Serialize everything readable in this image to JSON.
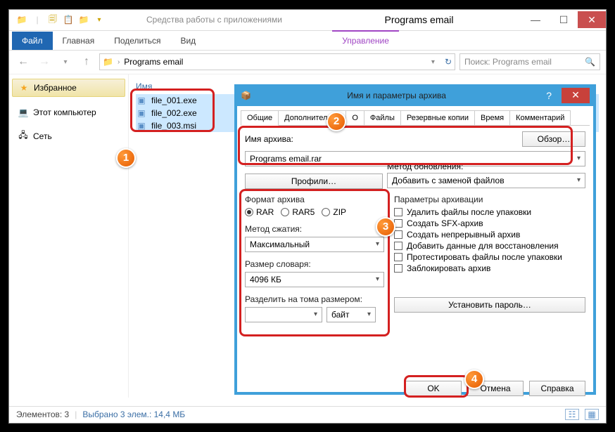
{
  "window": {
    "context_tab": "Средства работы с приложениями",
    "title": "Programs email"
  },
  "ribbon": {
    "file": "Файл",
    "home": "Главная",
    "share": "Поделиться",
    "view": "Вид",
    "ctx": "Управление"
  },
  "nav": {
    "folder": "Programs email",
    "search_placeholder": "Поиск: Programs email"
  },
  "sidebar": {
    "favorites": "Избранное",
    "pc": "Этот компьютер",
    "network": "Сеть"
  },
  "files": {
    "header": "Имя",
    "items": [
      "file_001.exe",
      "file_002.exe",
      "file_003.msi"
    ]
  },
  "status": {
    "elements": "Элементов: 3",
    "selected": "Выбрано 3 элем.: 14,4 МБ"
  },
  "dialog": {
    "title": "Имя и параметры архива",
    "tabs": [
      "Общие",
      "Дополнительно",
      "О",
      "Файлы",
      "Резервные копии",
      "Время",
      "Комментарий"
    ],
    "archive_name_label": "Имя архива:",
    "browse": "Обзор…",
    "archive_name": "Programs email.rar",
    "update_label": "Метод обновления:",
    "update_value": "Добавить с заменой файлов",
    "profiles": "Профили…",
    "format_label": "Формат архива",
    "formats": [
      "RAR",
      "RAR5",
      "ZIP"
    ],
    "method_label": "Метод сжатия:",
    "method_value": "Максимальный",
    "dict_label": "Размер словаря:",
    "dict_value": "4096 КБ",
    "split_label": "Разделить на тома размером:",
    "split_unit": "байт",
    "params_label": "Параметры архивации",
    "checks": [
      "Удалить файлы после упаковки",
      "Создать SFX-архив",
      "Создать непрерывный архив",
      "Добавить данные для восстановления",
      "Протестировать файлы после упаковки",
      "Заблокировать архив"
    ],
    "password": "Установить пароль…",
    "ok": "OK",
    "cancel": "Отмена",
    "help": "Справка"
  }
}
